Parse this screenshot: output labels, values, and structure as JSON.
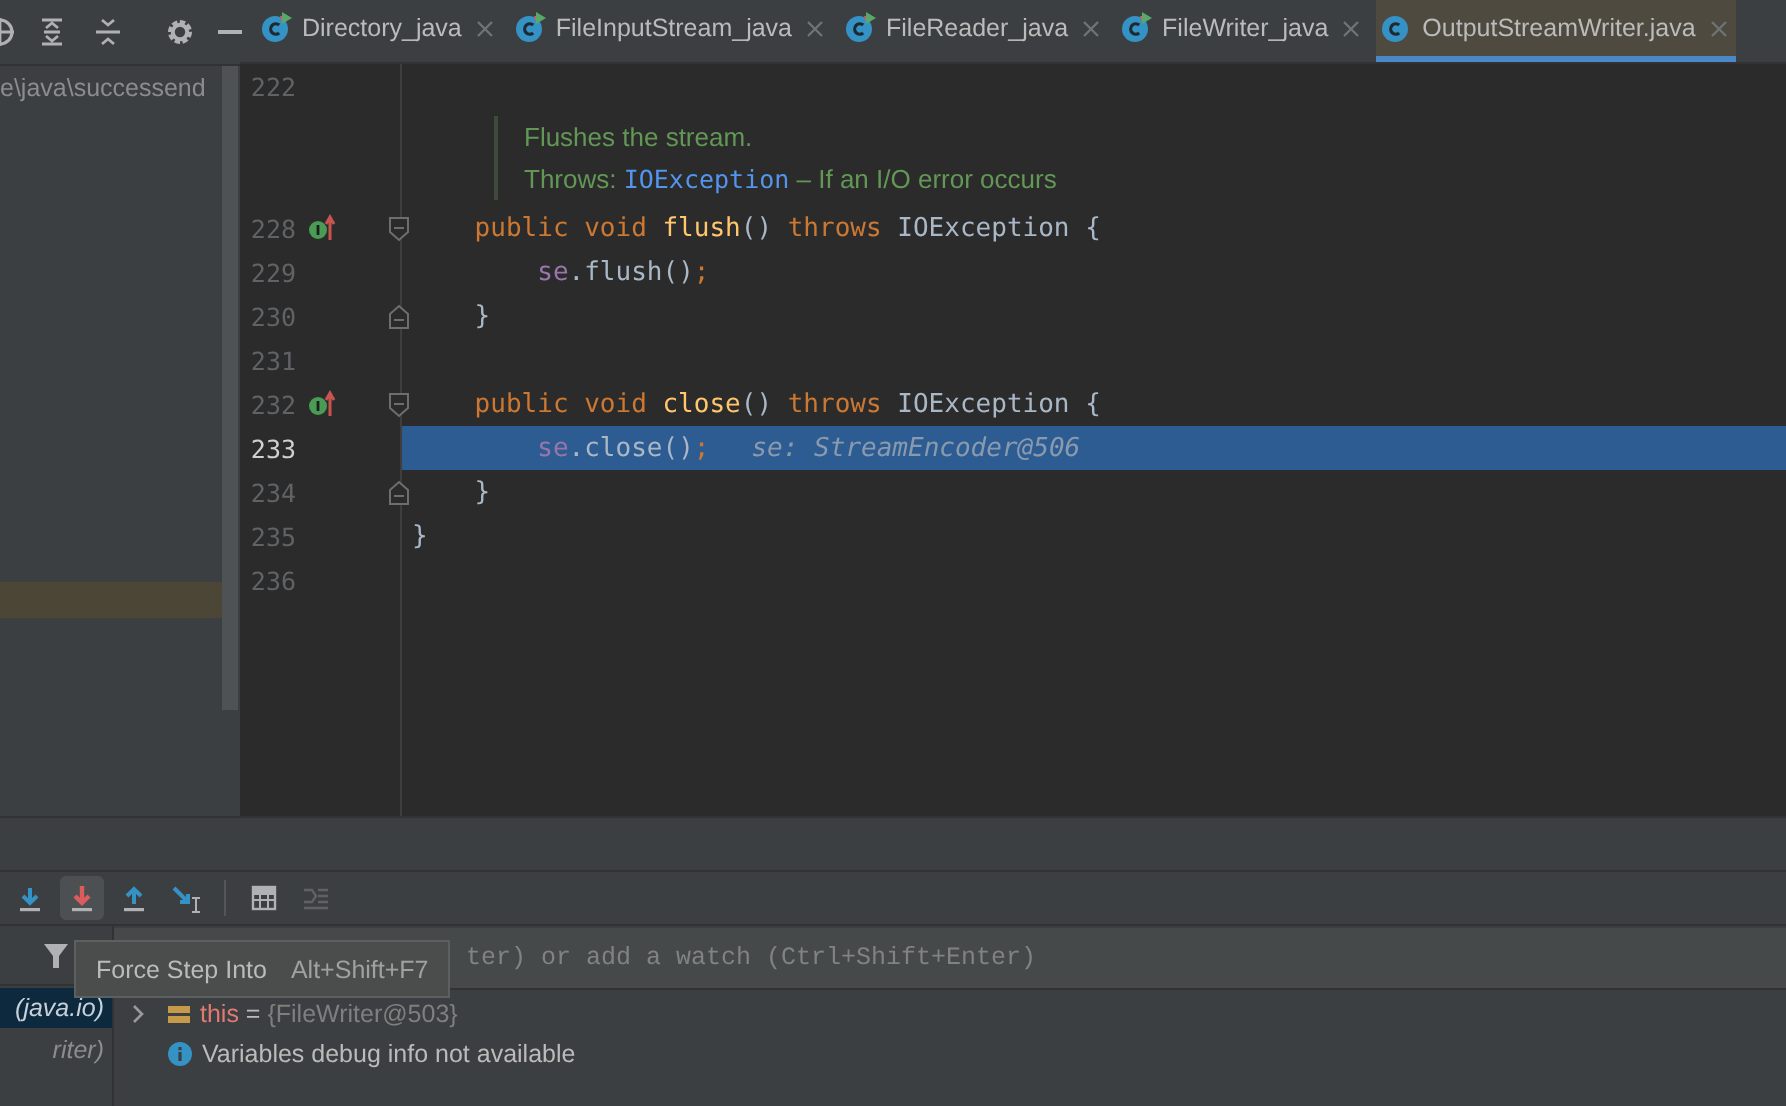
{
  "project_tree": {
    "path_text": "e\\java\\successend",
    "has_selection": true
  },
  "tabs": [
    {
      "label": "Directory_java",
      "selected": false,
      "runnable": true
    },
    {
      "label": "FileInputStream_java",
      "selected": false,
      "runnable": true
    },
    {
      "label": "FileReader_java",
      "selected": false,
      "runnable": true
    },
    {
      "label": "FileWriter_java",
      "selected": false,
      "runnable": true
    },
    {
      "label": "OutputStreamWriter.java",
      "selected": true,
      "runnable": false
    }
  ],
  "editor": {
    "lines": [
      {
        "kind": "code",
        "number": "222",
        "current": false
      },
      {
        "kind": "doc",
        "summary": "Flushes the stream.",
        "throws_label": "Throws:",
        "exception": "IOException",
        "description": " – If an I/O error occurs"
      },
      {
        "kind": "code",
        "number": "228",
        "current": false,
        "override": true,
        "fold_open": true,
        "tokens": [
          {
            "kind": "keyword",
            "text": "    public void "
          },
          {
            "kind": "method",
            "text": "flush"
          },
          {
            "kind": "plain",
            "text": "() "
          },
          {
            "kind": "keyword",
            "text": "throws "
          },
          {
            "kind": "plain",
            "text": "IOException {"
          }
        ]
      },
      {
        "kind": "code",
        "number": "229",
        "current": false,
        "tokens": [
          {
            "kind": "field",
            "text": "        se"
          },
          {
            "kind": "plain",
            "text": ".flush()"
          },
          {
            "kind": "keyword",
            "text": ";"
          }
        ]
      },
      {
        "kind": "code",
        "number": "230",
        "current": false,
        "fold_close": true,
        "tokens": [
          {
            "kind": "plain",
            "text": "    }"
          }
        ]
      },
      {
        "kind": "code",
        "number": "231",
        "current": false
      },
      {
        "kind": "code",
        "number": "232",
        "current": false,
        "override": true,
        "fold_open": true,
        "tokens": [
          {
            "kind": "keyword",
            "text": "    public void "
          },
          {
            "kind": "method",
            "text": "close"
          },
          {
            "kind": "plain",
            "text": "() "
          },
          {
            "kind": "keyword",
            "text": "throws "
          },
          {
            "kind": "plain",
            "text": "IOException {"
          }
        ]
      },
      {
        "kind": "code",
        "number": "233",
        "current": true,
        "tokens": [
          {
            "kind": "field",
            "text": "        se"
          },
          {
            "kind": "plain",
            "text": ".close()"
          },
          {
            "kind": "keyword",
            "text": ";"
          },
          {
            "kind": "hint",
            "text": "se: StreamEncoder@506"
          }
        ]
      },
      {
        "kind": "code",
        "number": "234",
        "current": false,
        "fold_close": true,
        "tokens": [
          {
            "kind": "plain",
            "text": "    }"
          }
        ]
      },
      {
        "kind": "code",
        "number": "235",
        "current": false,
        "tokens": [
          {
            "kind": "plain",
            "text": "}"
          }
        ]
      },
      {
        "kind": "code",
        "number": "236",
        "current": false
      }
    ]
  },
  "debug_toolbar": [
    {
      "kind": "step-over",
      "hovered": false,
      "disabled": false
    },
    {
      "kind": "force-step-into",
      "hovered": true,
      "disabled": false
    },
    {
      "kind": "step-out",
      "hovered": false,
      "disabled": false
    },
    {
      "kind": "run-to-cursor",
      "hovered": false,
      "disabled": false
    },
    {
      "kind": "evaluate",
      "hovered": false,
      "disabled": false
    },
    {
      "kind": "trace",
      "hovered": false,
      "disabled": true
    }
  ],
  "tooltip": {
    "title": "Force Step Into",
    "shortcut": "Alt+Shift+F7"
  },
  "frames": [
    {
      "text": "(java.io)",
      "selected": true
    },
    {
      "text": "riter)",
      "selected": false
    }
  ],
  "watch_field": {
    "placeholder": "ter) or add a watch (Ctrl+Shift+Enter)"
  },
  "variables": [
    {
      "kind": "field",
      "name": "this",
      "equals": " = ",
      "value": "{FileWriter@503}"
    },
    {
      "kind": "info",
      "text": "Variables debug info not available"
    }
  ]
}
